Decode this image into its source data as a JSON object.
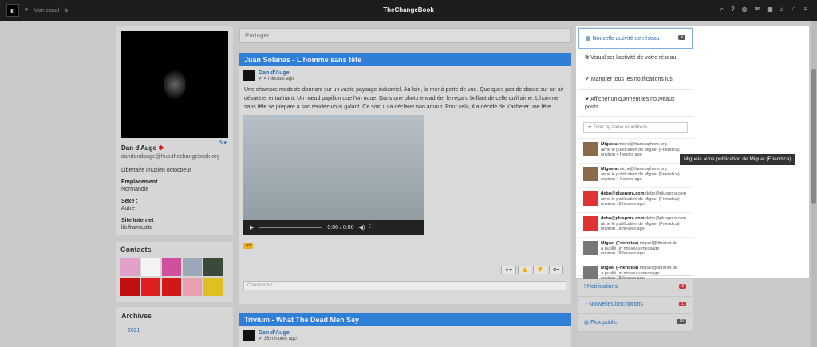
{
  "topbar": {
    "channel": "Mon canal",
    "brand": "TheChangeBook",
    "avatar_glyph": "◧"
  },
  "profile": {
    "name": "Dan d'Auge",
    "address": "dandandauge@hub.thechangebook.org",
    "bio": "Libertaire linuxien octocoeur",
    "location_label": "Emplacement :",
    "location": "Normandie",
    "sex_label": "Sexe :",
    "sex": "Autre",
    "site_label": "Site Internet :",
    "site": "lib.frama.site"
  },
  "contacts": {
    "title": "Contacts"
  },
  "archives": {
    "title": "Archives",
    "year": "2021"
  },
  "share": {
    "placeholder": "Partager"
  },
  "posts": [
    {
      "title": "Juan Solanas - L'homme sans tête",
      "author": "Dan d'Auge",
      "time": "4 minutes ago",
      "text": "Une chambre modeste donnant sur un vaste paysage industriel. Au loin, la mer à perte de vue. Quelques pas de danse sur un air désuet et entraînant. Un nœud papillon que l'on noue. Dans une photo encadrée, le regard brillant de celle qu'il aime. L'homme sans tête se prépare à son rendez-vous galant. Ce soir, il va déclarer son amour. Pour cela, il a décidé de s'acheter une tête.",
      "video_time": "0:00 / 0:00",
      "tag": "Art",
      "comment_placeholder": "Commenter"
    },
    {
      "title": "Trivium - What The Dead Men Say",
      "author": "Dan d'Auge",
      "time": "36 minutes ago"
    }
  ],
  "panel": {
    "menu": [
      {
        "label": "Nouvelle activité de réseau",
        "badge": "6"
      },
      {
        "label": "Visualiser l'activité de votre réseau"
      },
      {
        "label": "Marquer tous les notifications lus"
      },
      {
        "label": "Afficher uniquement les nouveaux posts"
      }
    ],
    "filter_placeholder": "Filter by name or address",
    "notifications": [
      {
        "name": "Miguela",
        "handle": "miche@framasphere.org",
        "action": "aime le publication de Miguel (Friendica)",
        "time": "environ 4 heures ago",
        "color": "#8a6a4a"
      },
      {
        "name": "Miguela",
        "handle": "miche@framasphere.org",
        "action": "aime le publication de Miguel (Friendica)",
        "time": "environ 4 heures ago",
        "color": "#8a6a4a"
      },
      {
        "name": "debo@pluspora.com",
        "handle": "debo@pluspora.com",
        "action": "aime le publication de Miguel (Friendica)",
        "time": "environ 18 heures ago",
        "color": "#d33"
      },
      {
        "name": "debo@pluspora.com",
        "handle": "debo@pluspora.com",
        "action": "aime le publication de Miguel (Friendica)",
        "time": "environ 18 heures ago",
        "color": "#d33"
      },
      {
        "name": "Miguel (Friendica)",
        "handle": "miguel@libranet.de",
        "action": "a publié un nouveau message",
        "time": "environ 18 heures ago",
        "color": "#777"
      },
      {
        "name": "Miguel (Friendica)",
        "handle": "miguel@libranet.de",
        "action": "a publié un nouveau message",
        "time": "environ 18 heures ago",
        "color": "#777"
      }
    ],
    "tooltip": "Miguela aime publication de Miguel (Friendica)"
  },
  "side_links": [
    {
      "label": "Notifications",
      "badge": "3"
    },
    {
      "label": "Nouvelles inscriptions",
      "badge": "1"
    },
    {
      "label": "Flux public",
      "badge": "10"
    }
  ]
}
